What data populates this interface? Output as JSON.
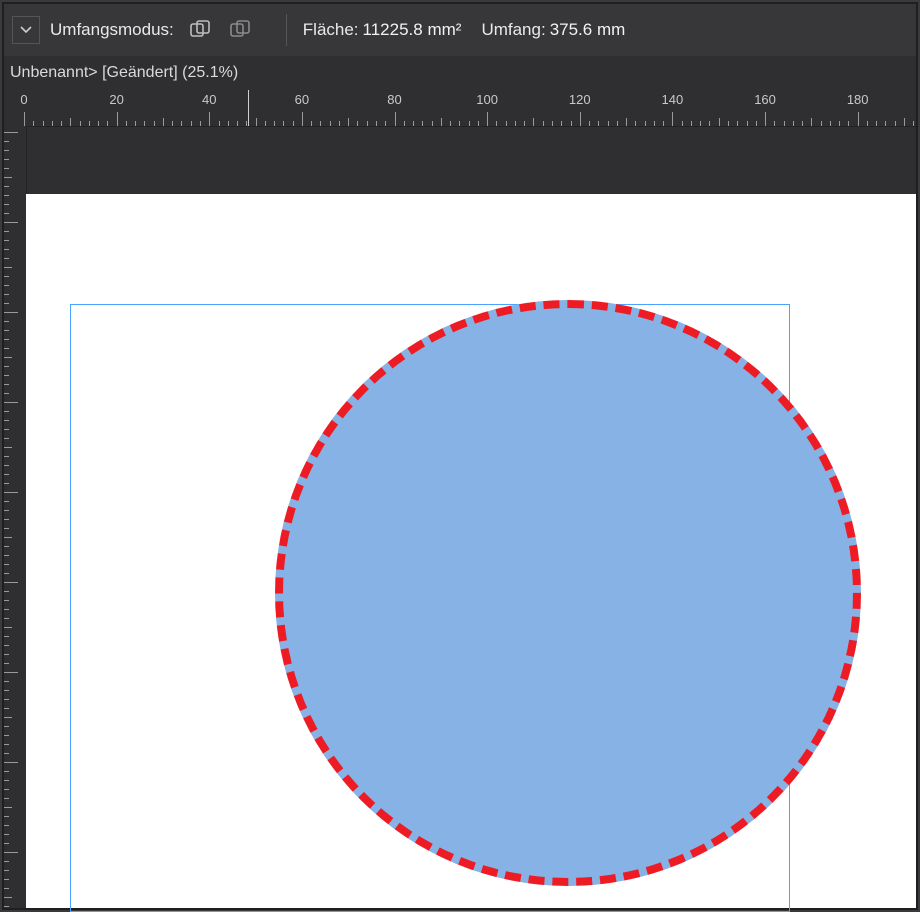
{
  "toolbar": {
    "mode_label": "Umfangsmodus:",
    "area_label": "Fläche:",
    "area_value": "11225.8 mm²",
    "perim_label": "Umfang:",
    "perim_value": "375.6 mm"
  },
  "tab": {
    "title": "Unbenannt> [Geändert] (25.1%)"
  },
  "ruler": {
    "labels": [
      "0",
      "20",
      "40",
      "60",
      "80",
      "100",
      "120",
      "140",
      "160",
      "180"
    ]
  }
}
